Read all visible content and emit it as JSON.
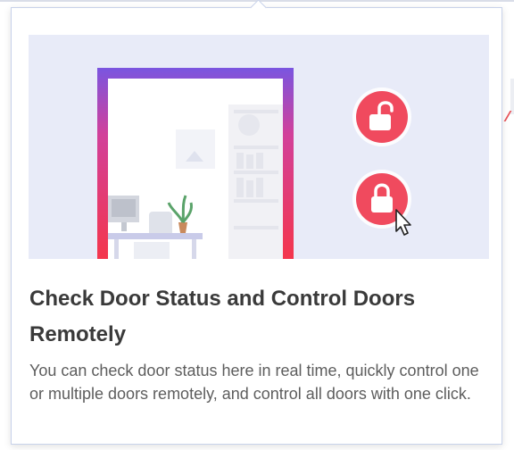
{
  "guide": {
    "title": "Check Door Status and Control Doors Remotely",
    "description": "You can check door status here in real time, quickly control one or multiple doors remotely, and control all doors with one click."
  },
  "illustration": {
    "icons": [
      "unlocked-padlock-icon",
      "locked-padlock-icon",
      "mouse-cursor-icon"
    ],
    "colors": {
      "background": "#e8ebf8",
      "door_frame_top": "#7a55e0",
      "door_frame_bottom": "#f4364c",
      "lock_button": "#f04a5e"
    }
  }
}
